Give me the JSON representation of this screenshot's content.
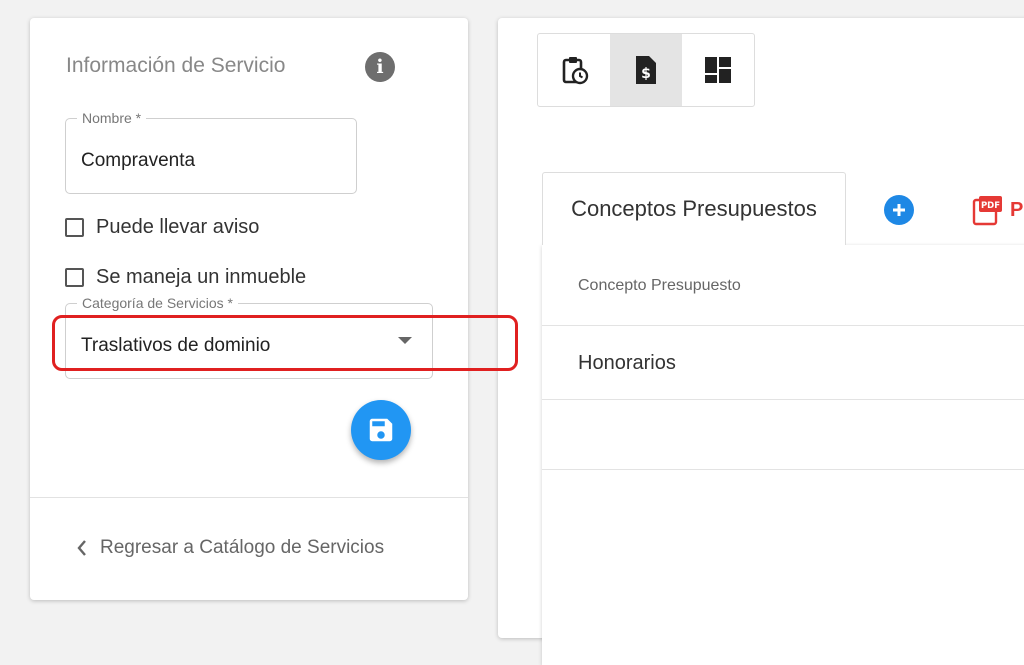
{
  "service_info": {
    "title": "Información de Servicio",
    "info_icon_glyph": "i",
    "nombre": {
      "label": "Nombre *",
      "value": "Compraventa"
    },
    "checkboxes": [
      {
        "label": "Puede llevar aviso",
        "checked": false
      },
      {
        "label": "Se maneja un inmueble",
        "checked": false
      }
    ],
    "categoria": {
      "label": "Categoría de Servicios *",
      "value": "Traslativos de dominio"
    },
    "save_icon": "save-icon",
    "back_link": "Regresar a Catálogo de Servicios"
  },
  "toolbar": {
    "buttons": [
      {
        "icon": "clipboard-clock-icon",
        "active": false
      },
      {
        "icon": "invoice-dollar-icon",
        "active": true
      },
      {
        "icon": "dashboard-icon",
        "active": false
      }
    ]
  },
  "concepts": {
    "tab_label": "Conceptos Presupuestos",
    "add_icon": "add-circle-icon",
    "pdf_badge": "PDF",
    "pdf_label": "P",
    "table": {
      "header": "Concepto Presupuesto",
      "rows": [
        "Honorarios"
      ]
    }
  },
  "colors": {
    "accent": "#2196f3",
    "highlight": "#e02020",
    "pdf": "#e53935"
  }
}
